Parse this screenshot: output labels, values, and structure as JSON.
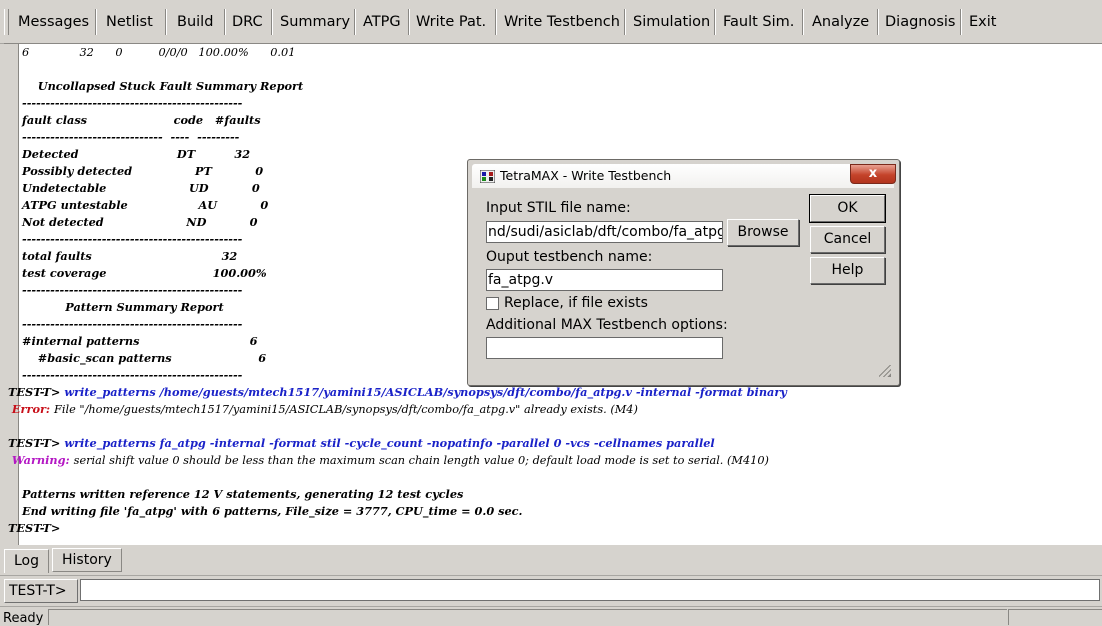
{
  "menubar": {
    "items": [
      "Messages",
      "Netlist",
      "Build",
      "DRC",
      "Summary",
      "ATPG",
      "Write Pat.",
      "Write Testbench",
      "Simulation",
      "Fault Sim.",
      "Analyze",
      "Diagnosis",
      "Exit"
    ]
  },
  "log": {
    "lines": [
      {
        "text": "6              32      0          0/0/0   100.00%      0.01"
      },
      {
        "text": ""
      },
      {
        "text": "    Uncollapsed Stuck Fault Summary Report",
        "bold": true
      },
      {
        "text": "-----------------------------------------------",
        "bold": true
      },
      {
        "text": "fault class                      code   #faults",
        "bold": true
      },
      {
        "text": "------------------------------  ----  ---------",
        "bold": true
      },
      {
        "text": "Detected                         DT          32",
        "bold": true
      },
      {
        "text": "Possibly detected                PT           0",
        "bold": true
      },
      {
        "text": "Undetectable                     UD           0",
        "bold": true
      },
      {
        "text": "ATPG untestable                  AU           0",
        "bold": true
      },
      {
        "text": "Not detected                     ND           0",
        "bold": true
      },
      {
        "text": "-----------------------------------------------",
        "bold": true
      },
      {
        "text": "total faults                                 32",
        "bold": true
      },
      {
        "text": "test coverage                           100.00%",
        "bold": true
      },
      {
        "text": "-----------------------------------------------",
        "bold": true
      },
      {
        "text": "           Pattern Summary Report",
        "bold": true
      },
      {
        "text": "-----------------------------------------------",
        "bold": true
      },
      {
        "text": "#internal patterns                            6",
        "bold": true
      },
      {
        "text": "    #basic_scan patterns                      6",
        "bold": true
      },
      {
        "text": "-----------------------------------------------",
        "bold": true
      },
      {
        "prefix": "TEST-T> ",
        "text": "write_patterns /home/guests/mtech1517/yamini15/ASICLAB/synopsys/dft/combo/fa_atpg.v -internal -format binary",
        "kind": "cmd",
        "indent": -2
      },
      {
        "prefix": " Error: ",
        "text": "File \"/home/guests/mtech1517/yamini15/ASICLAB/synopsys/dft/combo/fa_atpg.v\" already exists. (M4)",
        "kind": "err",
        "indent": -2
      },
      {
        "text": ""
      },
      {
        "prefix": "TEST-T> ",
        "text": "write_patterns fa_atpg -internal -format stil -cycle_count -nopatinfo -parallel 0 -vcs -cellnames parallel",
        "kind": "cmd",
        "indent": -2
      },
      {
        "prefix": " Warning: ",
        "text": "serial shift value 0 should be less than the maximum scan chain length value 0; default load mode is set to serial. (M410)",
        "kind": "warn",
        "indent": -2
      },
      {
        "text": ""
      },
      {
        "text": "Patterns written reference 12 V statements, generating 12 test cycles",
        "bold": true
      },
      {
        "text": "End writing file 'fa_atpg' with 6 patterns, File_size = 3777, CPU_time = 0.0 sec.",
        "bold": true
      },
      {
        "prefix": "TEST-T>",
        "text": "",
        "kind": "cmd",
        "indent": -2
      }
    ]
  },
  "tabs": {
    "log": "Log",
    "history": "History"
  },
  "command": {
    "prompt": "TEST-T>",
    "value": ""
  },
  "status": {
    "text": "Ready"
  },
  "dialog": {
    "title": "TetraMAX - Write Testbench",
    "close_glyph": "x",
    "input_stil_label": "Input STIL file name:",
    "input_stil_value": "nd/sudi/asiclab/dft/combo/fa_atpg",
    "browse_label": "Browse",
    "output_label": "Ouput testbench name:",
    "output_value": "fa_atpg.v",
    "replace_label": "Replace, if file exists",
    "replace_checked": false,
    "options_label": "Additional MAX Testbench options:",
    "options_value": "",
    "ok_label": "OK",
    "cancel_label": "Cancel",
    "help_label": "Help"
  }
}
